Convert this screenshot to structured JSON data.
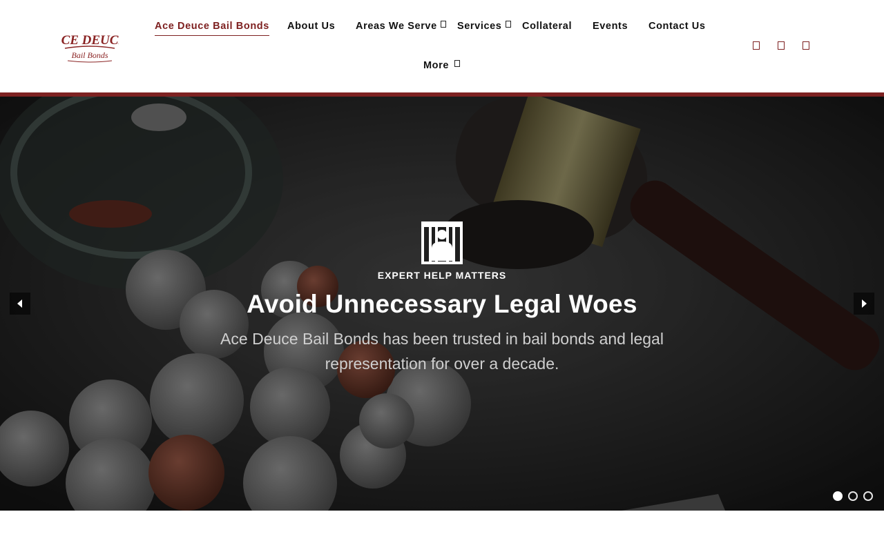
{
  "brand": {
    "name": "Ace Deuce Bail Bonds",
    "logo_text_top": "ACE DEUCE",
    "logo_text_bottom": "Bail Bonds",
    "accent_color": "#7d2222"
  },
  "nav": {
    "items": [
      {
        "label": "Ace Deuce Bail Bonds",
        "active": true,
        "has_dropdown": false
      },
      {
        "label": "About Us",
        "active": false,
        "has_dropdown": false
      },
      {
        "label": "Areas We Serve",
        "active": false,
        "has_dropdown": true
      },
      {
        "label": "Services",
        "active": false,
        "has_dropdown": true
      },
      {
        "label": "Collateral",
        "active": false,
        "has_dropdown": false
      },
      {
        "label": "Events",
        "active": false,
        "has_dropdown": false
      },
      {
        "label": "Contact Us",
        "active": false,
        "has_dropdown": false
      },
      {
        "label": "More",
        "active": false,
        "has_dropdown": true
      }
    ]
  },
  "social": {
    "icons": [
      "facebook-icon",
      "instagram-icon",
      "twitter-icon"
    ]
  },
  "hero": {
    "icon": "jail-icon",
    "eyebrow": "EXPERT HELP MATTERS",
    "headline": "Avoid Unnecessary Legal Woes",
    "subtext": "Ace Deuce Bail Bonds has been trusted in bail bonds and legal representation for over a decade.",
    "slide_count": 3,
    "active_slide": 1
  }
}
